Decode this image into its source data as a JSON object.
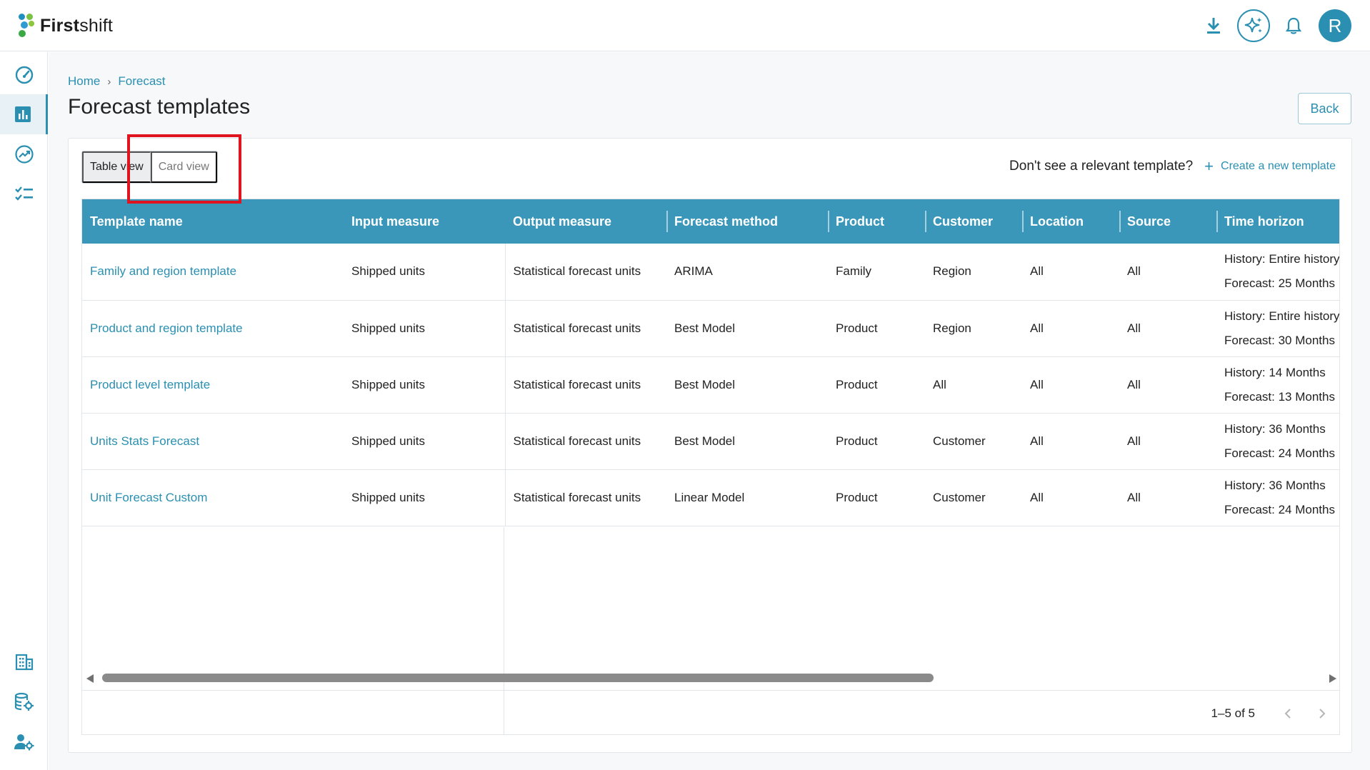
{
  "app": {
    "name_bold": "First",
    "name_rest": "shift",
    "avatar_initial": "R",
    "accent_color": "#2a8fb1"
  },
  "top_icons": [
    "download-icon",
    "ai-sparkle-icon",
    "bell-icon"
  ],
  "sidebar": {
    "items": [
      {
        "icon": "dashboard-gauge-icon"
      },
      {
        "icon": "bar-chart-icon",
        "active": true
      },
      {
        "icon": "trend-chart-icon"
      },
      {
        "icon": "checklist-icon"
      },
      {
        "icon": "building-icon"
      },
      {
        "icon": "database-settings-icon"
      },
      {
        "icon": "user-settings-icon"
      }
    ]
  },
  "breadcrumb": {
    "home": "Home",
    "sep": "›",
    "current": "Forecast"
  },
  "page": {
    "title": "Forecast templates",
    "back_label": "Back"
  },
  "view_toggle": {
    "table_label": "Table view",
    "card_label": "Card view",
    "selected": "table"
  },
  "prompt": {
    "question": "Don't see a relevant template?",
    "plus": "+",
    "create_label": "Create a new template"
  },
  "table": {
    "columns": [
      "Template name",
      "Input measure",
      "Output measure",
      "Forecast method",
      "Product",
      "Customer",
      "Location",
      "Source",
      "Time horizon"
    ],
    "rows": [
      {
        "name": "Family and region template",
        "input": "Shipped units",
        "output": "Statistical forecast units",
        "method": "ARIMA",
        "product": "Family",
        "customer": "Region",
        "location": "All",
        "source": "All",
        "history": "History: Entire history",
        "forecast": "Forecast: 25 Months"
      },
      {
        "name": "Product and region template",
        "input": "Shipped units",
        "output": "Statistical forecast units",
        "method": "Best Model",
        "product": "Product",
        "customer": "Region",
        "location": "All",
        "source": "All",
        "history": "History: Entire history",
        "forecast": "Forecast: 30 Months"
      },
      {
        "name": "Product level template",
        "input": "Shipped units",
        "output": "Statistical forecast units",
        "method": "Best Model",
        "product": "Product",
        "customer": "All",
        "location": "All",
        "source": "All",
        "history": "History: 14 Months",
        "forecast": "Forecast: 13 Months"
      },
      {
        "name": "Units Stats Forecast",
        "input": "Shipped units",
        "output": "Statistical forecast units",
        "method": "Best Model",
        "product": "Product",
        "customer": "Customer",
        "location": "All",
        "source": "All",
        "history": "History: 36 Months",
        "forecast": "Forecast: 24 Months"
      },
      {
        "name": "Unit Forecast Custom",
        "input": "Shipped units",
        "output": "Statistical forecast units",
        "method": "Linear Model",
        "product": "Product",
        "customer": "Customer",
        "location": "All",
        "source": "All",
        "history": "History: 36 Months",
        "forecast": "Forecast: 24 Months"
      }
    ]
  },
  "pagination": {
    "range_text": "1–5 of 5"
  }
}
